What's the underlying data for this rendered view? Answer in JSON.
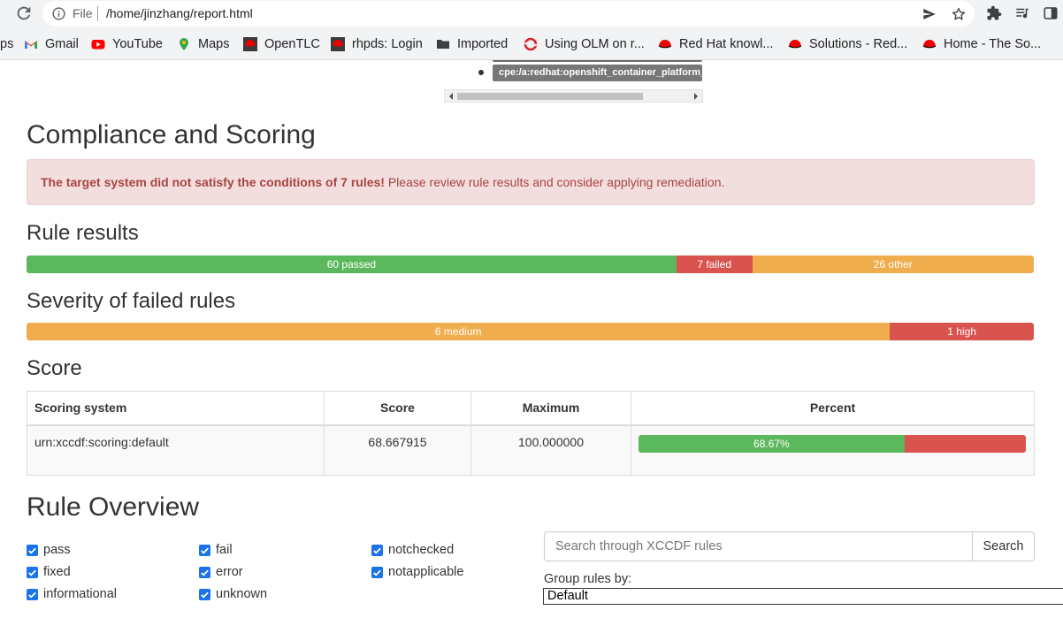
{
  "browser": {
    "file_label": "File",
    "url": "/home/jinzhang/report.html",
    "bookmarks": [
      {
        "label": "Gmail",
        "icon": "gmail-icon"
      },
      {
        "label": "YouTube",
        "icon": "youtube-icon"
      },
      {
        "label": "Maps",
        "icon": "maps-icon"
      },
      {
        "label": "OpenTLC",
        "icon": "redhat-icon"
      },
      {
        "label": "rhpds: Login",
        "icon": "redhat-icon"
      },
      {
        "label": "Imported",
        "icon": "folder-icon"
      },
      {
        "label": "Using OLM on r...",
        "icon": "openshift-icon"
      },
      {
        "label": "Red Hat knowl...",
        "icon": "redhat-hat-icon"
      },
      {
        "label": "Solutions - Red...",
        "icon": "redhat-hat-icon"
      },
      {
        "label": "Home - The So...",
        "icon": "redhat-hat-icon"
      }
    ],
    "bookmarks_leading": "ps"
  },
  "page": {
    "cpe_badge": "cpe:/a:redhat:openshift_container_platform_ou",
    "compliance_title": "Compliance and Scoring",
    "alert_bold": "The target system did not satisfy the conditions of 7 rules!",
    "alert_text": " Please review rule results and consider applying remediation.",
    "rule_results_title": "Rule results",
    "rule_results": [
      {
        "label": "60 passed",
        "count": 60,
        "color": "#5cb85c"
      },
      {
        "label": "7 failed",
        "count": 7,
        "color": "#d9534f"
      },
      {
        "label": "26 other",
        "count": 26,
        "color": "#f0ad4e"
      }
    ],
    "severity_title": "Severity of failed rules",
    "severity": [
      {
        "label": "6 medium",
        "count": 6,
        "color": "#f0ad4e"
      },
      {
        "label": "1 high",
        "count": 1,
        "color": "#d9534f"
      }
    ],
    "score_title": "Score",
    "score_table": {
      "headers": [
        "Scoring system",
        "Score",
        "Maximum",
        "Percent"
      ],
      "row": {
        "system": "urn:xccdf:scoring:default",
        "score": "68.667915",
        "maximum": "100.000000",
        "percent_label": "68.67%",
        "percent_value": 68.67
      }
    },
    "overview_title": "Rule Overview",
    "filters": [
      {
        "label": "pass",
        "checked": true
      },
      {
        "label": "fixed",
        "checked": true
      },
      {
        "label": "informational",
        "checked": true
      },
      {
        "label": "fail",
        "checked": true
      },
      {
        "label": "error",
        "checked": true
      },
      {
        "label": "unknown",
        "checked": true
      },
      {
        "label": "notchecked",
        "checked": true
      },
      {
        "label": "notapplicable",
        "checked": true
      }
    ],
    "search_placeholder": "Search through XCCDF rules",
    "search_button": "Search",
    "group_label": "Group rules by:",
    "group_value": "Default"
  }
}
